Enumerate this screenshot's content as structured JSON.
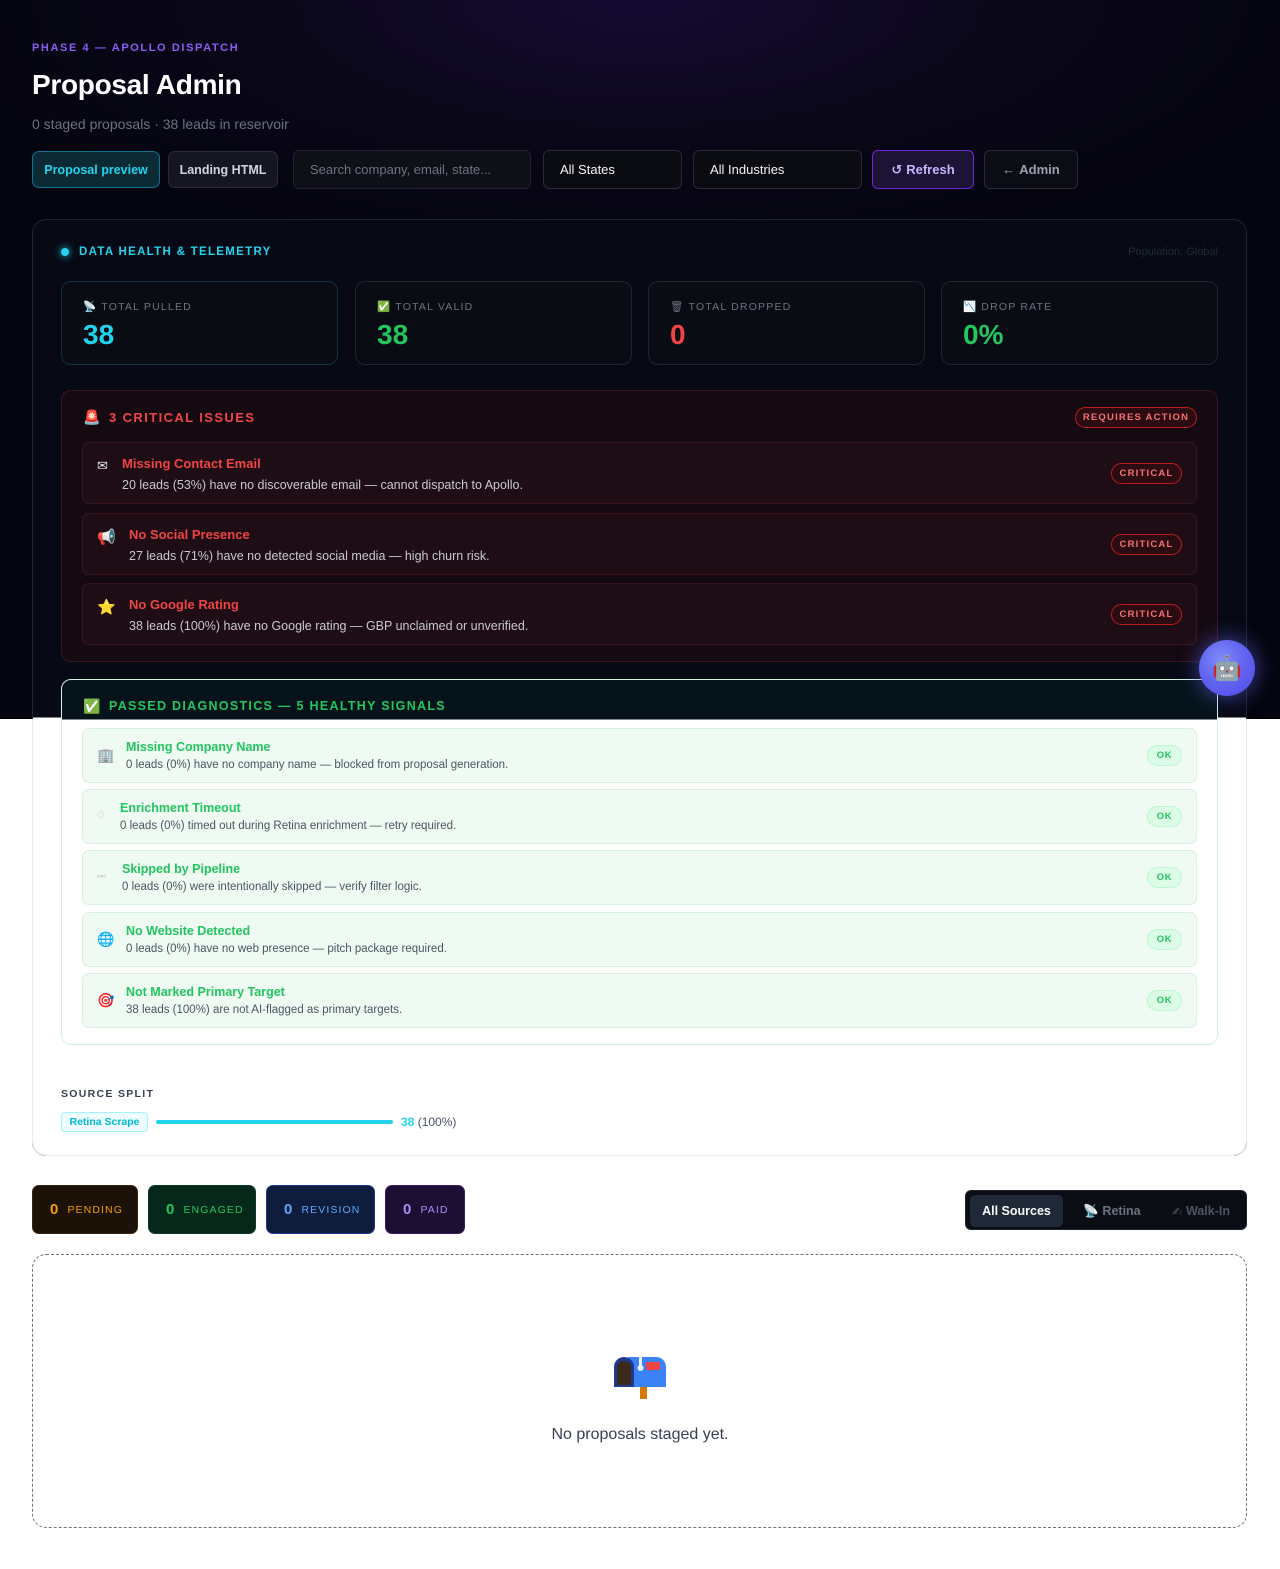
{
  "header": {
    "eyebrow": "PHASE 4 — APOLLO DISPATCH",
    "title": "Proposal Admin",
    "subtitle": "0 staged proposals  · 38 leads in reservoir"
  },
  "toolbar": {
    "proposal_preview": "Proposal preview",
    "landing_html": "Landing HTML",
    "search_placeholder": "Search company, email, state...",
    "states_selected": "All States",
    "industries_selected": "All Industries",
    "refresh_icon": "↺",
    "refresh": "Refresh",
    "admin_icon": "←",
    "admin": "Admin"
  },
  "telemetry": {
    "title": "DATA HEALTH & TELEMETRY",
    "population": "Population: Global",
    "stats": [
      {
        "icon": "📡",
        "label": "TOTAL PULLED",
        "value": "38",
        "color": "#22d3ee"
      },
      {
        "icon": "✅",
        "label": "TOTAL VALID",
        "value": "38",
        "color": "#22c55e"
      },
      {
        "icon": "🗑",
        "label": "TOTAL DROPPED",
        "value": "0",
        "color": "#ef4444"
      },
      {
        "icon": "📉",
        "label": "DROP RATE",
        "value": "0%",
        "color": "#22c55e"
      }
    ]
  },
  "critical": {
    "icon": "🚨",
    "title": "3 CRITICAL ISSUES",
    "badge": "REQUIRES ACTION",
    "items": [
      {
        "icon": "✉",
        "title": "Missing Contact Email",
        "desc": "20 leads (53%) have no discoverable email — cannot dispatch to Apollo.",
        "badge": "CRITICAL"
      },
      {
        "icon": "📢",
        "title": "No Social Presence",
        "desc": "27 leads (71%) have no detected social media — high churn risk.",
        "badge": "CRITICAL"
      },
      {
        "icon": "⭐",
        "title": "No Google Rating",
        "desc": "38 leads (100%) have no Google rating — GBP unclaimed or unverified.",
        "badge": "CRITICAL"
      }
    ]
  },
  "passed": {
    "icon": "✅",
    "title": "PASSED DIAGNOSTICS — 5 HEALTHY SIGNALS",
    "items": [
      {
        "icon": "🏢",
        "title": "Missing Company Name",
        "desc": "0 leads (0%) have no company name — blocked from proposal generation.",
        "badge": "OK"
      },
      {
        "icon": "⏱",
        "title": "Enrichment Timeout",
        "desc": "0 leads (0%) timed out during Retina enrichment — retry required.",
        "badge": "OK"
      },
      {
        "icon": "⏭",
        "title": "Skipped by Pipeline",
        "desc": "0 leads (0%) were intentionally skipped — verify filter logic.",
        "badge": "OK"
      },
      {
        "icon": "🌐",
        "title": "No Website Detected",
        "desc": "0 leads (0%) have no web presence — pitch package required.",
        "badge": "OK"
      },
      {
        "icon": "🎯",
        "title": "Not Marked Primary Target",
        "desc": "38 leads (100%) are not AI-flagged as primary targets.",
        "badge": "OK"
      }
    ]
  },
  "source_split": {
    "title": "SOURCE SPLIT",
    "source": "Retina Scrape",
    "count": "38",
    "percent_label": "(100%)",
    "fraction": 1.0
  },
  "statuses": [
    {
      "count": "0",
      "label": "PENDING"
    },
    {
      "count": "0",
      "label": "ENGAGED"
    },
    {
      "count": "0",
      "label": "REVISION"
    },
    {
      "count": "0",
      "label": "PAID"
    }
  ],
  "source_filter": {
    "all": "All Sources",
    "retina_icon": "📡",
    "retina": "Retina",
    "walkin_icon": "✍",
    "walkin": "Walk-In"
  },
  "empty_state": {
    "icon": "mailbox-icon",
    "text": "No proposals staged yet."
  },
  "assistant_fab": {
    "icon": "🤖"
  }
}
